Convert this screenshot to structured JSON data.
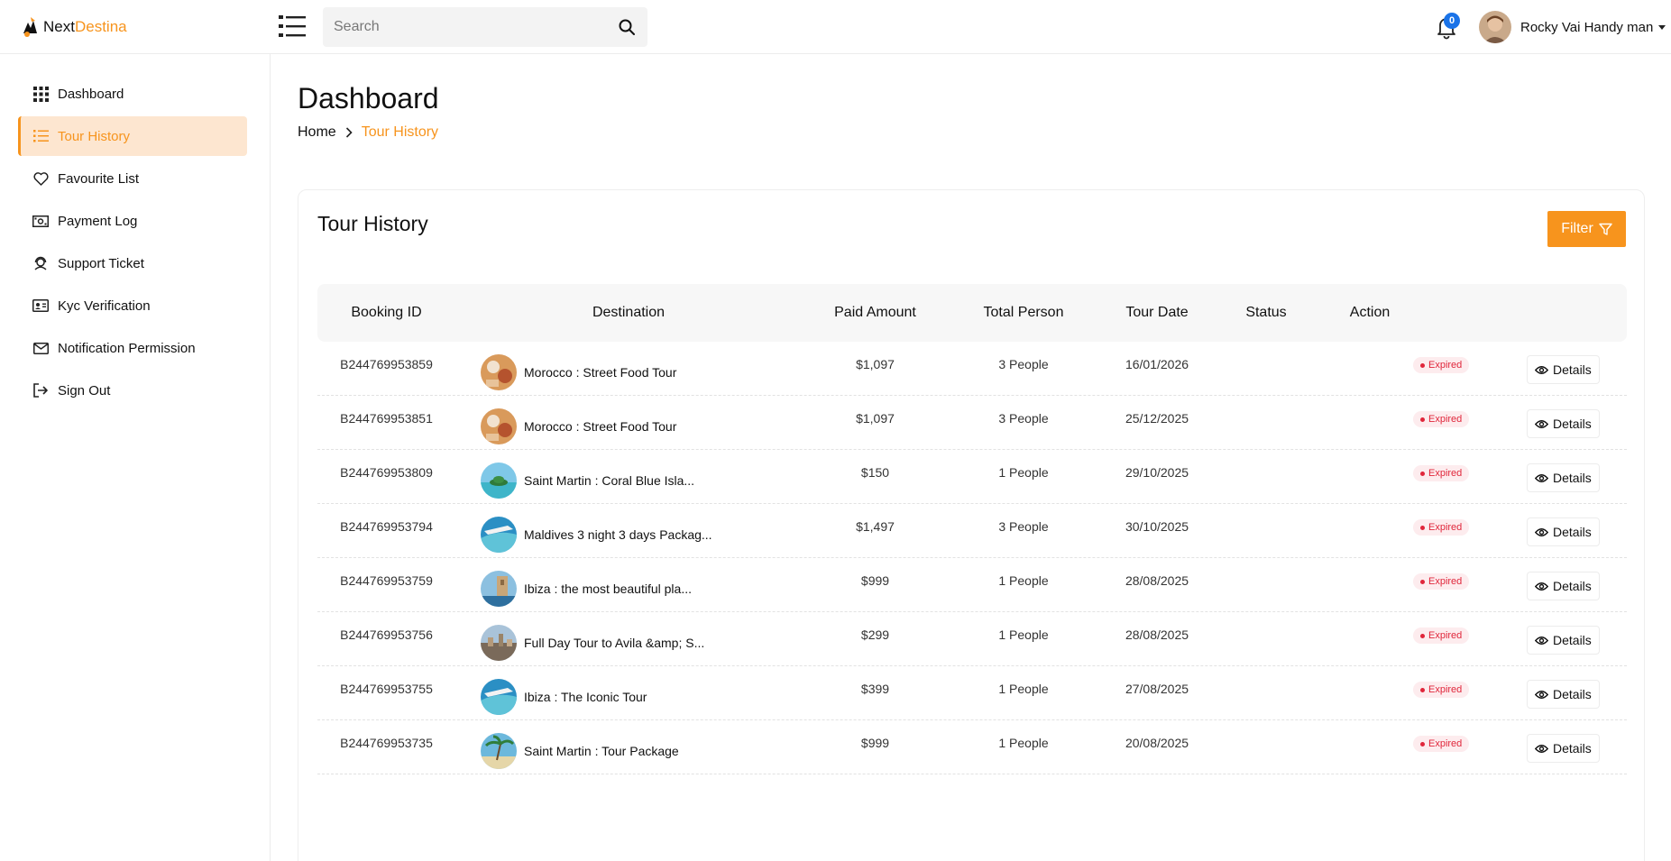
{
  "header": {
    "logo_primary": "Next",
    "logo_accent": "Destina",
    "search_placeholder": "Search",
    "notification_count": "0",
    "user_name": "Rocky Vai Handy man"
  },
  "sidebar": {
    "items": [
      {
        "label": "Dashboard",
        "icon": "grid-icon",
        "active": false
      },
      {
        "label": "Tour History",
        "icon": "list-icon",
        "active": true
      },
      {
        "label": "Favourite List",
        "icon": "heart-icon",
        "active": false
      },
      {
        "label": "Payment Log",
        "icon": "cash-icon",
        "active": false
      },
      {
        "label": "Support Ticket",
        "icon": "support-icon",
        "active": false
      },
      {
        "label": "Kyc Verification",
        "icon": "id-card-icon",
        "active": false
      },
      {
        "label": "Notification Permission",
        "icon": "envelope-icon",
        "active": false
      },
      {
        "label": "Sign Out",
        "icon": "sign-out-icon",
        "active": false
      }
    ]
  },
  "page": {
    "title": "Dashboard",
    "breadcrumb_home": "Home",
    "breadcrumb_current": "Tour History"
  },
  "card": {
    "title": "Tour History",
    "filter_label": "Filter"
  },
  "table": {
    "columns": [
      "Booking ID",
      "Destination",
      "Paid Amount",
      "Total Person",
      "Tour Date",
      "Status",
      "Action"
    ],
    "action_label": "Details",
    "rows": [
      {
        "booking_id": "B244769953859",
        "destination": "Morocco : Street Food Tour",
        "amount": "$1,097",
        "persons": "3 People",
        "date": "16/01/2026",
        "status": "Expired",
        "thumb": "food"
      },
      {
        "booking_id": "B244769953851",
        "destination": "Morocco : Street Food Tour",
        "amount": "$1,097",
        "persons": "3 People",
        "date": "25/12/2025",
        "status": "Expired",
        "thumb": "food"
      },
      {
        "booking_id": "B244769953809",
        "destination": "Saint Martin : Coral Blue Isla...",
        "amount": "$150",
        "persons": "1 People",
        "date": "29/10/2025",
        "status": "Expired",
        "thumb": "island"
      },
      {
        "booking_id": "B244769953794",
        "destination": "Maldives 3 night 3 days Packag...",
        "amount": "$1,497",
        "persons": "3 People",
        "date": "30/10/2025",
        "status": "Expired",
        "thumb": "sea"
      },
      {
        "booking_id": "B244769953759",
        "destination": "Ibiza : the most beautiful pla...",
        "amount": "$999",
        "persons": "1 People",
        "date": "28/08/2025",
        "status": "Expired",
        "thumb": "coast"
      },
      {
        "booking_id": "B244769953756",
        "destination": "Full Day Tour to Avila &amp; S...",
        "amount": "$299",
        "persons": "1 People",
        "date": "28/08/2025",
        "status": "Expired",
        "thumb": "city"
      },
      {
        "booking_id": "B244769953755",
        "destination": "Ibiza : The Iconic Tour",
        "amount": "$399",
        "persons": "1 People",
        "date": "27/08/2025",
        "status": "Expired",
        "thumb": "sea"
      },
      {
        "booking_id": "B244769953735",
        "destination": "Saint Martin : Tour Package",
        "amount": "$999",
        "persons": "1 People",
        "date": "20/08/2025",
        "status": "Expired",
        "thumb": "palm"
      }
    ]
  },
  "colors": {
    "accent": "#f7941d",
    "active_bg": "#fde6d0",
    "badge_blue": "#1a73e8",
    "status_expired": "#e0263b"
  }
}
